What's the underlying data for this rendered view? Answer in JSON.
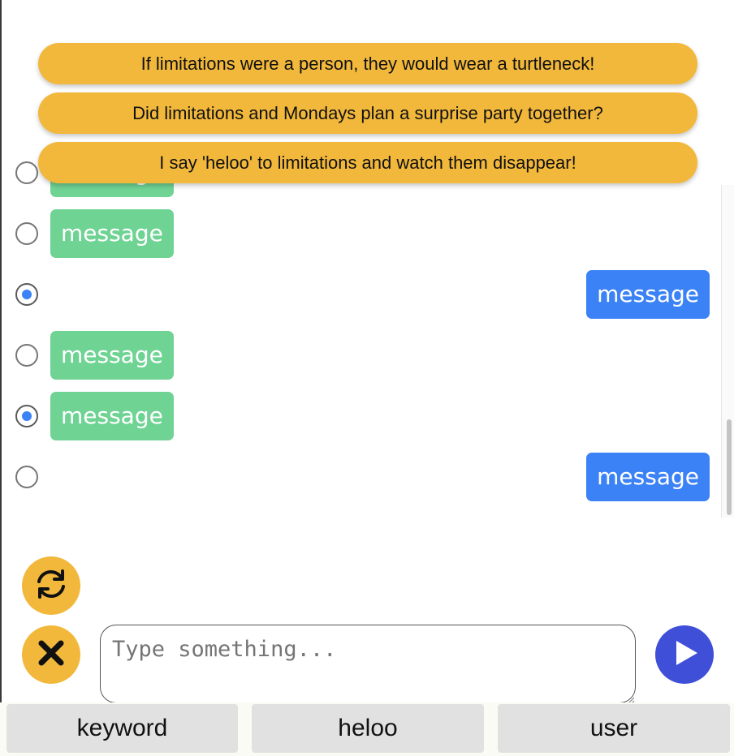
{
  "suggestions": [
    "If limitations were a person, they would wear a turtleneck!",
    "Did limitations and Mondays plan a surprise party together?",
    "I say 'heloo' to limitations and watch them disappear!"
  ],
  "messages": [
    {
      "text": "message",
      "side": "in",
      "selected": false
    },
    {
      "text": "message",
      "side": "in",
      "selected": false
    },
    {
      "text": "message",
      "side": "out",
      "selected": true
    },
    {
      "text": "message",
      "side": "in",
      "selected": false
    },
    {
      "text": "message",
      "side": "in",
      "selected": true
    },
    {
      "text": "message",
      "side": "out",
      "selected": false
    }
  ],
  "input": {
    "placeholder": "Type something...",
    "value": ""
  },
  "buttons": {
    "refresh_icon": "refresh-icon",
    "clear_icon": "close-icon",
    "send_icon": "play-icon"
  },
  "keywords": [
    "keyword",
    "heloo",
    "user"
  ],
  "colors": {
    "accent": "#f2b83b",
    "incoming": "#6fd394",
    "outgoing": "#3b82f6",
    "send": "#3f4fd8"
  }
}
